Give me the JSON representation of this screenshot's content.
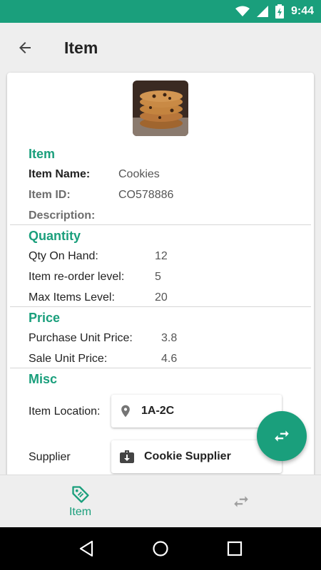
{
  "status": {
    "time": "9:44"
  },
  "appbar": {
    "title": "Item"
  },
  "item_section": {
    "title": "Item",
    "name_label": "Item Name:",
    "name_value": "Cookies",
    "id_label": "Item ID:",
    "id_value": "CO578886",
    "description_label": "Description:"
  },
  "quantity_section": {
    "title": "Quantity",
    "rows": [
      {
        "label": "Qty On Hand:",
        "value": "12"
      },
      {
        "label": "Item re-order level:",
        "value": "5"
      },
      {
        "label": "Max Items Level:",
        "value": "20"
      }
    ]
  },
  "price_section": {
    "title": "Price",
    "rows": [
      {
        "label": "Purchase Unit Price:",
        "value": "3.8"
      },
      {
        "label": "Sale Unit Price:",
        "value": "4.6"
      }
    ]
  },
  "misc_section": {
    "title": "Misc",
    "location_label": "Item Location:",
    "location_value": "1A-2C",
    "supplier_label": "Supplier",
    "supplier_value": "Cookie Supplier"
  },
  "bottom_nav": {
    "item_tab_label": "Item"
  },
  "colors": {
    "accent": "#1a9f7c",
    "status_bar": "#1a9f7c"
  },
  "icons": [
    "wifi-icon",
    "signal-icon",
    "battery-charging-icon",
    "back-arrow-icon",
    "location-pin-icon",
    "briefcase-download-icon",
    "swap-arrows-icon",
    "tag-icon",
    "nav-back-icon",
    "nav-home-icon",
    "nav-recents-icon"
  ]
}
